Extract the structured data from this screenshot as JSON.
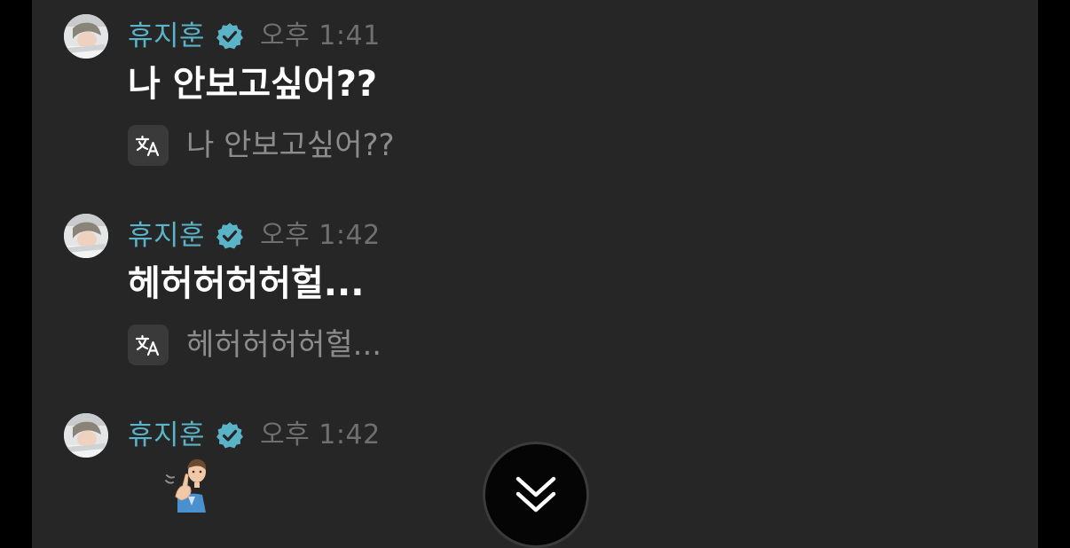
{
  "messages": [
    {
      "sender": "휴지훈",
      "time": "오후 1:41",
      "text": "나 안보고싶어??",
      "translation": "나 안보고싶어??"
    },
    {
      "sender": "휴지훈",
      "time": "오후 1:42",
      "text": "헤허허허허헐...",
      "translation": "헤허허허허헐..."
    },
    {
      "sender": "휴지훈",
      "time": "오후 1:42",
      "emoji": "shushing-man-emoji"
    }
  ],
  "icons": {
    "verified": "verified-badge-icon",
    "translate": "translate-icon",
    "scroll_down": "double-chevron-down-icon"
  },
  "colors": {
    "sender_name": "#5ab3c6",
    "verified_badge": "#5ab3c6",
    "timestamp": "#6f6f6f",
    "message_text": "#ffffff",
    "translation_text": "#8c8c8c",
    "background": "#262626"
  }
}
